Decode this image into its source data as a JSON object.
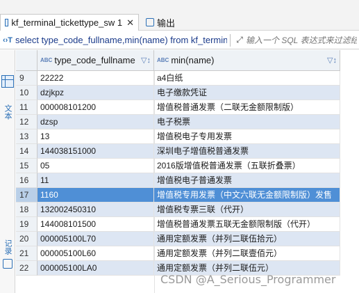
{
  "tabs": [
    {
      "label": "kf_terminal_tickettype_sw 1",
      "close": "✕",
      "icon": "table-icon"
    },
    {
      "label": "输出",
      "icon": "output-icon"
    }
  ],
  "filter": {
    "icon": "filter-icon",
    "query": "select type_code_fullname,min(name) from kf_termin",
    "placeholder": "输入一个 SQL 表达式来过滤结"
  },
  "sidebar": {
    "text_label": "文本",
    "record_label": "记录"
  },
  "table": {
    "columns": [
      {
        "type_badge": "ABC",
        "label": "type_code_fullname"
      },
      {
        "type_badge": "ABC",
        "label": "min(name)"
      }
    ],
    "rows": [
      {
        "num": "9",
        "a": "22222",
        "b": "a4白纸"
      },
      {
        "num": "10",
        "a": "dzjkpz",
        "b": "电子缴款凭证"
      },
      {
        "num": "11",
        "a": "000008101200",
        "b": "增值税普通发票（二联无金额限制版）"
      },
      {
        "num": "12",
        "a": "dzsp",
        "b": "电子税票"
      },
      {
        "num": "13",
        "a": "13",
        "b": "增值税电子专用发票"
      },
      {
        "num": "14",
        "a": "144038151000",
        "b": "深圳电子增值税普通发票"
      },
      {
        "num": "15",
        "a": "05",
        "b": "2016版增值税普通发票（五联折叠票）"
      },
      {
        "num": "16",
        "a": "11",
        "b": "增值税电子普通发票"
      },
      {
        "num": "17",
        "a": "1160",
        "b": "增值税专用发票（中文六联无金额限制版）发售"
      },
      {
        "num": "18",
        "a": "132002450310",
        "b": "增值税专票三联（代开）"
      },
      {
        "num": "19",
        "a": "144008101500",
        "b": "增值税普通发票五联无金额限制版（代开）"
      },
      {
        "num": "20",
        "a": "000005100L70",
        "b": "通用定额发票（并列二联伍拾元）"
      },
      {
        "num": "21",
        "a": "000005100L60",
        "b": "通用定额发票（并列二联壹佰元）"
      },
      {
        "num": "22",
        "a": "000005100LA0",
        "b": "通用定额发票（并列二联伍元）"
      }
    ],
    "selected_row": "17"
  },
  "watermark": "CSDN @A_Serious_Programmer"
}
